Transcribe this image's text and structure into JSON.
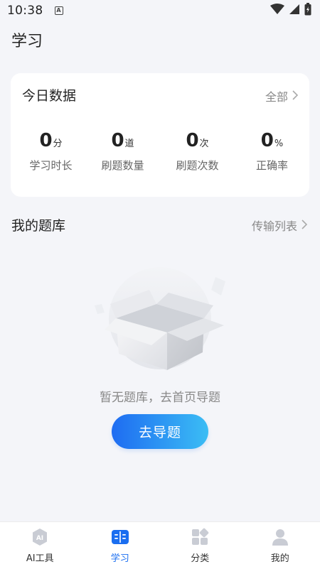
{
  "status_bar": {
    "time": "10:38",
    "notification_icon": "A"
  },
  "page_title": "学习",
  "today": {
    "title": "今日数据",
    "more_label": "全部",
    "stats": [
      {
        "value": "0",
        "unit": "分",
        "label": "学习时长"
      },
      {
        "value": "0",
        "unit": "道",
        "label": "刷题数量"
      },
      {
        "value": "0",
        "unit": "次",
        "label": "刷题次数"
      },
      {
        "value": "0",
        "unit": "%",
        "label": "正确率"
      }
    ]
  },
  "bank": {
    "title": "我的题库",
    "more_label": "传输列表",
    "empty_text": "暂无题库，去首页导题",
    "cta_label": "去导题"
  },
  "tabbar": {
    "items": [
      {
        "label": "AI工具",
        "icon": "ai-icon",
        "badge": "AI"
      },
      {
        "label": "学习",
        "icon": "book-icon",
        "active": true
      },
      {
        "label": "分类",
        "icon": "category-icon"
      },
      {
        "label": "我的",
        "icon": "profile-icon"
      }
    ]
  },
  "colors": {
    "accent": "#1a6ef0",
    "gradient_start": "#1e6cf2",
    "gradient_end": "#3bbdf4"
  }
}
